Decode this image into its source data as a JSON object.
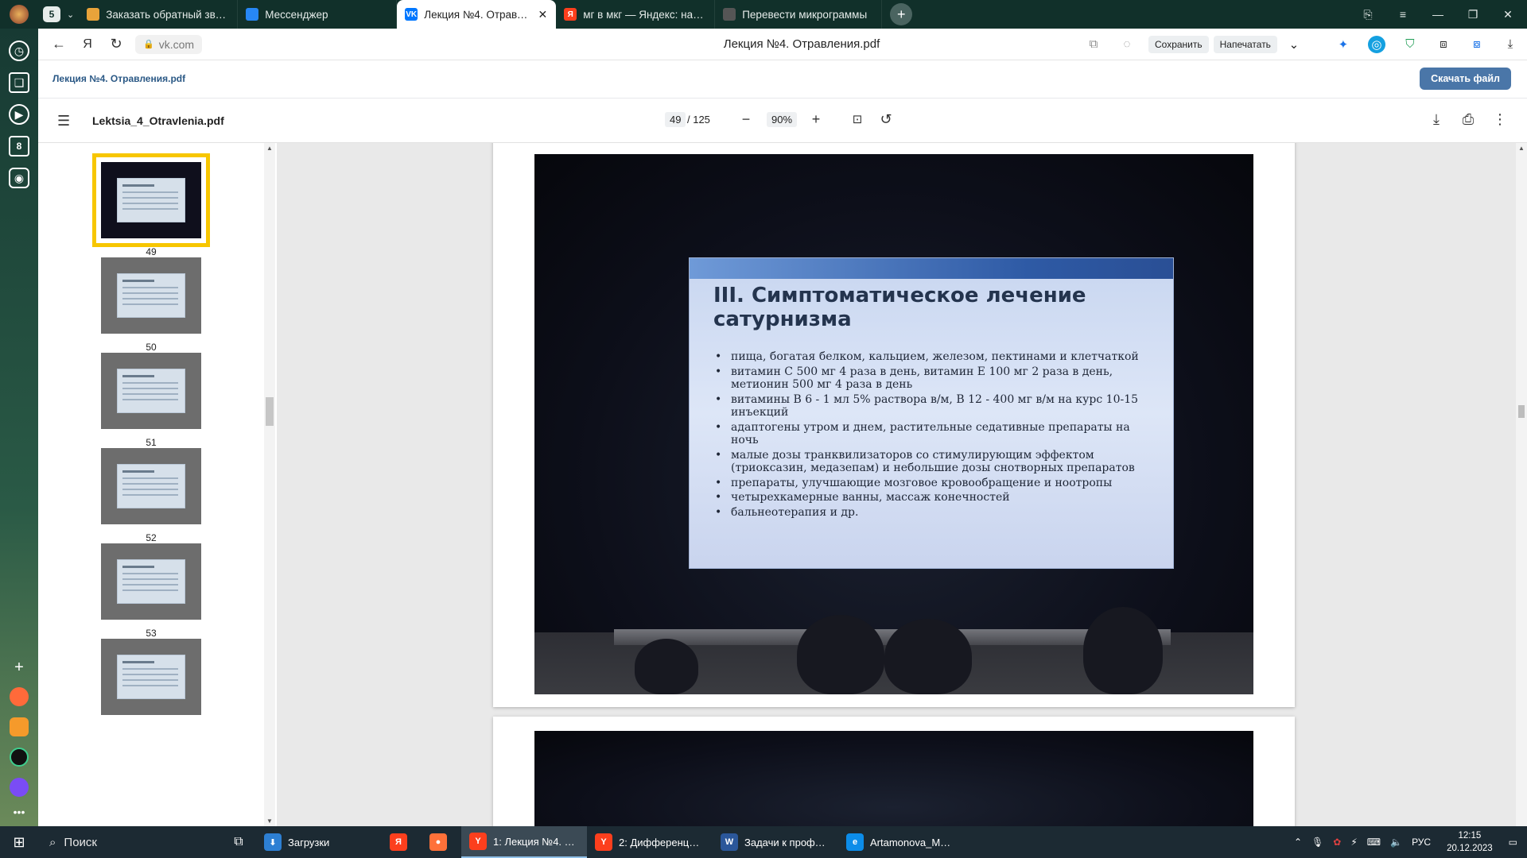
{
  "browser": {
    "tabs": [
      {
        "label": "Заказать обратный звонок",
        "color": "#e8a33a"
      },
      {
        "label": "Мессенджер",
        "color": "#2787f5"
      },
      {
        "label": "Лекция №4. Отравления",
        "color": "#0077ff",
        "glyph": "VK"
      },
      {
        "label": "мг в мкг — Яндекс: нашлось",
        "color": "#fc3f1d",
        "glyph": "Я"
      },
      {
        "label": "Перевести микрограммы",
        "color": "#555555"
      }
    ],
    "tab_count_badge": "5",
    "url": "vk.com",
    "page_title": "Лекция №4. Отравления.pdf",
    "save_label": "Сохранить",
    "print_label": "Напечатать"
  },
  "vk": {
    "file_name": "Лекция №4. Отравления.pdf",
    "download_label": "Скачать файл"
  },
  "pdf_toolbar": {
    "doc_name": "Lektsia_4_Otravlenia.pdf",
    "current_page": "49",
    "total_pages": "/ 125",
    "zoom": "90%"
  },
  "thumbnails": [
    {
      "num": "49",
      "selected": true
    },
    {
      "num": "50",
      "selected": false
    },
    {
      "num": "51",
      "selected": false
    },
    {
      "num": "52",
      "selected": false
    },
    {
      "num": "53",
      "selected": false
    },
    {
      "num": "",
      "selected": false
    }
  ],
  "slide": {
    "title_line1": "III. Симптоматическое лечение",
    "title_line2": "сатурнизма",
    "items": [
      "пища, богатая белком, кальцием, железом, пектинами и клетчаткой",
      "витамин С 500 мг 4 раза в день, витамин Е 100 мг 2 раза в день, метионин 500 мг 4 раза в день",
      "витамины В 6 - 1 мл 5% раствора в/м, В 12 - 400 мг в/м  на курс 10-15 инъекций",
      "адаптогены утром и днем, растительные седативные препараты на ночь",
      "малые дозы транквилизаторов со стимулирующим эффектом (триоксазин, медазепам) и небольшие дозы снотворных препаратов",
      "препараты, улучшающие мозговое кровообращение и ноотропы",
      "четырехкамерные ванны,  массаж конечностей",
      "бальнеотерапия и др."
    ]
  },
  "taskbar": {
    "search_label": "Поиск",
    "apps": [
      {
        "label": "Загрузки",
        "color": "#2d7fd3",
        "glyph": "⬇",
        "active": false
      },
      {
        "label": "",
        "color": "#fc3f1d",
        "glyph": "Я",
        "active": false
      },
      {
        "label": "",
        "color": "#ff7139",
        "glyph": "●",
        "active": false
      },
      {
        "label": "1: Лекция №4. Отр...",
        "color": "#fc3f1d",
        "glyph": "Y",
        "active": true
      },
      {
        "label": "2: Дифференциал...",
        "color": "#fc3f1d",
        "glyph": "Y",
        "active": false
      },
      {
        "label": "Задачи к профбол...",
        "color": "#2b579a",
        "glyph": "W",
        "active": false
      },
      {
        "label": "Artamonova_Mukh...",
        "color": "#0c8ce9",
        "glyph": "e",
        "active": false
      }
    ],
    "lang": "РУС",
    "time": "12:15",
    "date": "20.12.2023"
  }
}
